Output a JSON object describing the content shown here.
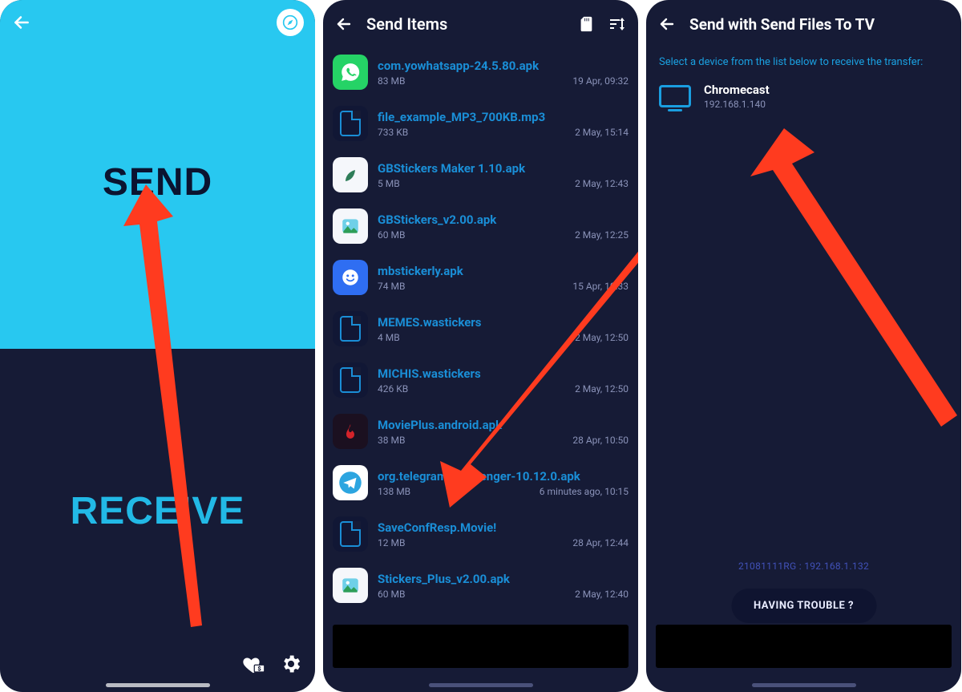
{
  "s1": {
    "send": "SEND",
    "receive": "RECEIVE"
  },
  "s2": {
    "title": "Send Items",
    "files": [
      {
        "name": "com.yowhatsapp-24.5.80.apk",
        "size": "83 MB",
        "date": "19 Apr, 09:32",
        "icon": "whatsapp"
      },
      {
        "name": "file_example_MP3_700KB.mp3",
        "size": "733 KB",
        "date": "2 May, 15:14",
        "icon": "doc"
      },
      {
        "name": "GBStickers Maker 1.10.apk",
        "size": "5 MB",
        "date": "2 May, 12:43",
        "icon": "leaf"
      },
      {
        "name": "GBStickers_v2.00.apk",
        "size": "60 MB",
        "date": "2 May, 12:25",
        "icon": "photo"
      },
      {
        "name": "mbstickerly.apk",
        "size": "74 MB",
        "date": "15 Apr, 10:33",
        "icon": "smiley"
      },
      {
        "name": "MEMES.wastickers",
        "size": "4 MB",
        "date": "2 May, 12:50",
        "icon": "doc"
      },
      {
        "name": "MICHIS.wastickers",
        "size": "426 KB",
        "date": "2 May, 12:50",
        "icon": "doc"
      },
      {
        "name": "MoviePlus.android.apk",
        "size": "38 MB",
        "date": "28 Apr, 10:50",
        "icon": "flame"
      },
      {
        "name": "org.telegram.messenger-10.12.0.apk",
        "size": "138 MB",
        "date": "6 minutes ago, 10:15",
        "icon": "telegram"
      },
      {
        "name": "SaveConfResp.Movie!",
        "size": "12 MB",
        "date": "28 Apr, 12:44",
        "icon": "doc"
      },
      {
        "name": "Stickers_Plus_v2.00.apk",
        "size": "60 MB",
        "date": "2 May, 12:40",
        "icon": "photo"
      }
    ]
  },
  "s3": {
    "title": "Send with Send Files To TV",
    "hint": "Select a device from the list below to receive the transfer:",
    "device": {
      "name": "Chromecast",
      "ip": "192.168.1.140"
    },
    "self_id": "21081111RG : 192.168.1.132",
    "trouble": "HAVING TROUBLE ?"
  }
}
